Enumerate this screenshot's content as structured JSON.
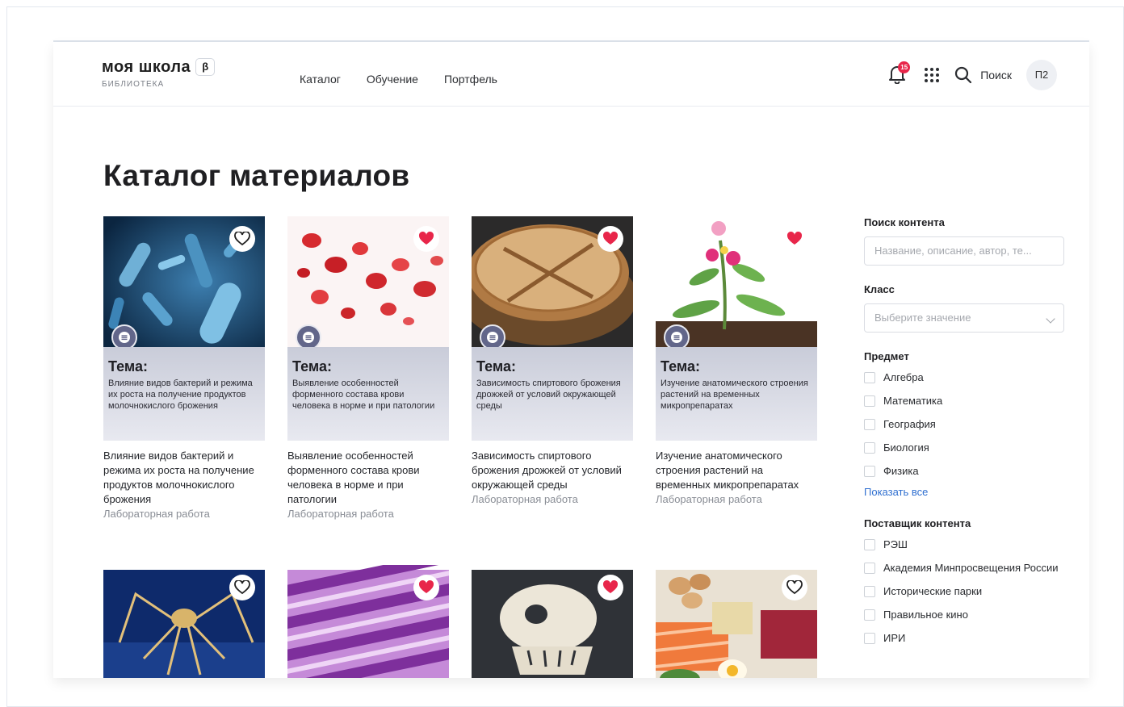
{
  "header": {
    "logo_title": "моя школа",
    "logo_beta": "β",
    "logo_subtitle": "БИБЛИОТЕКА",
    "nav": [
      "Каталог",
      "Обучение",
      "Портфель"
    ],
    "notification_count": "15",
    "search_label": "Поиск",
    "avatar_initials": "П2"
  },
  "page_title": "Каталог материалов",
  "cards": [
    {
      "theme_label": "Тема:",
      "theme_text": "Влияние видов бактерий и режима их роста на получение продуктов молочнокислого брожения",
      "desc": "Влияние видов бактерий и режима их роста на получение продуктов молочнокислого брожения",
      "type": "Лабораторная работа",
      "favorite": false
    },
    {
      "theme_label": "Тема:",
      "theme_text": "Выявление особенностей форменного состава крови человека в норме и при патологии",
      "desc": "Выявление особенностей форменного состава крови человека в норме и при патологии",
      "type": "Лабораторная работа",
      "favorite": true
    },
    {
      "theme_label": "Тема:",
      "theme_text": "Зависимость спиртового брожения дрожжей от условий окружающей среды",
      "desc": "Зависимость спиртового брожения дрожжей от условий окружающей среды",
      "type": "Лабораторная работа",
      "favorite": true
    },
    {
      "theme_label": "Тема:",
      "theme_text": "Изучение анатомического строения растений на временных микропрепаратах",
      "desc": "Изучение анатомического строения растений на временных микропрепаратах",
      "type": "Лабораторная работа",
      "favorite": true
    }
  ],
  "cards_row2_favorites": [
    false,
    true,
    true,
    false
  ],
  "sidebar": {
    "search_title": "Поиск контента",
    "search_placeholder": "Название, описание, автор, те...",
    "class_title": "Класс",
    "class_placeholder": "Выберите значение",
    "subject_title": "Предмет",
    "subjects": [
      "Алгебра",
      "Математика",
      "География",
      "Биология",
      "Физика"
    ],
    "show_all": "Показать все",
    "provider_title": "Поставщик контента",
    "providers": [
      "РЭШ",
      "Академия Минпросвещения России",
      "Исторические парки",
      "Правильное кино",
      "ИРИ"
    ]
  },
  "colors": {
    "accent_red": "#e8264a",
    "doc_icon": "#62668a",
    "link_blue": "#2f6fd0"
  }
}
